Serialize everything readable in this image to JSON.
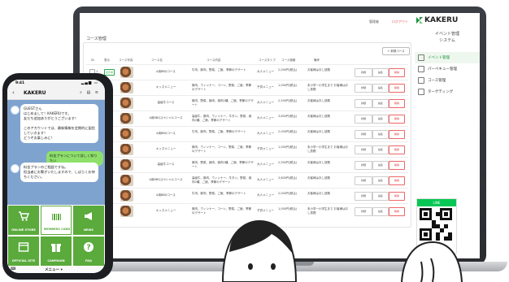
{
  "header": {
    "links": [
      "管理者",
      "ログアウト"
    ],
    "brand": "KAKERU",
    "system_title_1": "イベント管理",
    "system_title_2": "システム"
  },
  "sidebar": {
    "items": [
      {
        "label": "イベント管理",
        "active": true
      },
      {
        "label": "パーベキュー管理",
        "active": false
      },
      {
        "label": "コース管理",
        "active": false
      },
      {
        "label": "ターゲティング",
        "active": false
      }
    ],
    "line_label": "LINE"
  },
  "main": {
    "heading": "コース管理",
    "new_button": "+ 新規コース",
    "columns": [
      "ID",
      "表示",
      "コース写真",
      "コース名",
      "コース内容",
      "コースタイプ",
      "コース価格",
      "備考"
    ],
    "buttons": {
      "detail": "詳細",
      "edit": "編集",
      "delete": "削除"
    },
    "rows": [
      {
        "id": "1",
        "status": "表示中",
        "name": "A用BBQコース",
        "content": "牛肉、豚肉、野菜、ご飯、季節のデザート",
        "type": "大人メニュー",
        "price": "2,000円(税込)",
        "note": "お客様はおし放題"
      },
      {
        "id": "2",
        "status": "",
        "name": "キッズメニュー",
        "content": "豚肉、ウィンナー、コーン、野菜、ご飯、季節のデザート",
        "type": "子供メニュー",
        "price": "1,000円(税込)",
        "note": "未小学一小学生まで お客様はおし放題"
      },
      {
        "id": "3",
        "status": "",
        "name": "高級牛コース",
        "content": "豚肉、野菜、鶏肉、焼肉2種、ご飯、季節のデザート",
        "type": "大人メニュー",
        "price": "2,500円(税込)",
        "note": "お客様はおし放題"
      },
      {
        "id": "4",
        "status": "",
        "name": "A用BBQスペシャルコース",
        "content": "高級牛、豚肉、ウィンナー、牛タン、野菜、焼肉2種、ご飯、季節のデザート",
        "type": "大人メニュー",
        "price": "3,800円(税込)",
        "note": "お客様はおし放題"
      },
      {
        "id": "5",
        "status": "",
        "name": "A用BBQコース",
        "content": "牛肉、豚肉、野菜、ご飯、季節のデザート",
        "type": "大人メニュー",
        "price": "2,000円(税込)",
        "note": "お客様はおし放題"
      },
      {
        "id": "6",
        "status": "",
        "name": "キッズメニュー",
        "content": "豚肉、ウィンナー、コーン、野菜、ご飯、季節のデザート",
        "type": "子供メニュー",
        "price": "1,000円(税込)",
        "note": "未小学一小学生まで お客様はおし放題"
      },
      {
        "id": "7",
        "status": "",
        "name": "高級牛コース",
        "content": "豚肉、野菜、鶏肉、焼肉2種、ご飯、季節のデザート",
        "type": "大人メニュー",
        "price": "2,500円(税込)",
        "note": "お客様はおし放題"
      },
      {
        "id": "8",
        "status": "",
        "name": "A用BBQスペシャルコース",
        "content": "高級牛、豚肉、ウィンナー、牛タン、野菜、焼肉2種、ご飯、季節のデザート",
        "type": "大人メニュー",
        "price": "3,800円(税込)",
        "note": "お客様はおし放題"
      },
      {
        "id": "9",
        "status": "",
        "name": "A用BBQコース",
        "content": "牛肉、豚肉、野菜、ご飯、季節のデザート",
        "type": "大人メニュー",
        "price": "2,000円(税込)",
        "note": "お客様はおし放題"
      },
      {
        "id": "10",
        "status": "",
        "name": "キッズメニュー",
        "content": "豚肉、ウィンナー、コーン、野菜、ご飯、季節のデザート",
        "type": "子供メニュー",
        "price": "1,000円(税込)",
        "note": "未小学一小学生まで お客様はおし放題"
      }
    ]
  },
  "phone": {
    "time": "9:41",
    "chat_title": "KAKERU",
    "messages": [
      {
        "from": "bot",
        "text": "GUESTさん\nはじめまして！KAKERUです。\n友だち追加ありがとうございます！\n\nこのアカウントでは、最新情報を定期的に配信していきます！\nどうぞお楽しみに！"
      },
      {
        "from": "me",
        "text": "料金プランについて詳しく知りたい"
      },
      {
        "from": "bot",
        "text": "料金プランのご相談ですね。\n担当者にお繋ぎいたしますので、しばらくお待ちください。"
      }
    ],
    "rich_menu": [
      "ONLINE STORE",
      "MEMBERS CARD",
      "NEWS",
      "OFFICIAL SITE",
      "CAMPAIGN",
      "FAQ"
    ],
    "menu_label": "メニュー ▾"
  },
  "colors": {
    "line_green": "#06c755",
    "brand_green": "#1a8f3c",
    "rich_menu_green": "#5aaa3c",
    "chat_bg": "#7fa3cf"
  }
}
